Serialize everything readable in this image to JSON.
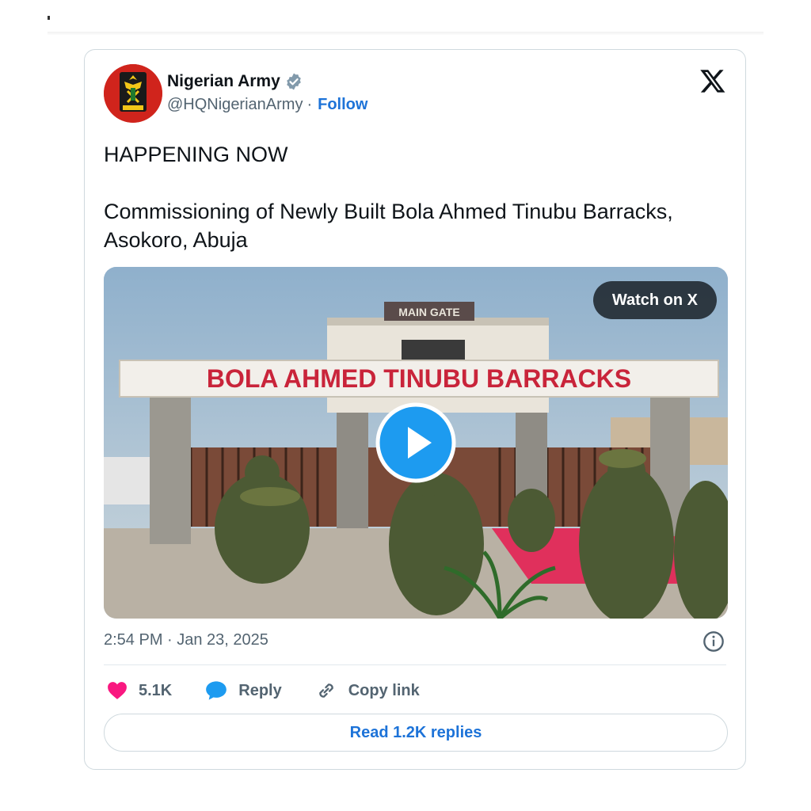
{
  "author": {
    "name": "Nigerian Army",
    "handle": "@HQNigerianArmy",
    "separator": "·",
    "follow_label": "Follow"
  },
  "tweet": {
    "line1": "HAPPENING NOW",
    "line2": "Commissioning of Newly Built Bola Ahmed Tinubu Barracks, Asokoro, Abuja",
    "timestamp": "2:54 PM · Jan 23, 2025"
  },
  "media": {
    "watch_label": "Watch on X",
    "sign_text": "BOLA AHMED TINUBU BARRACKS",
    "gate_text": "MAIN GATE"
  },
  "actions": {
    "likes": "5.1K",
    "reply_label": "Reply",
    "copy_label": "Copy link"
  },
  "read_replies_label": "Read 1.2K replies",
  "colors": {
    "accent": "#1d73d8",
    "like": "#f91880",
    "verified": "#829aab",
    "sign_text": "#c9243a"
  },
  "icons": [
    "verified-badge-icon",
    "x-logo-icon",
    "play-icon",
    "info-icon",
    "heart-icon",
    "reply-bubble-icon",
    "link-icon"
  ]
}
